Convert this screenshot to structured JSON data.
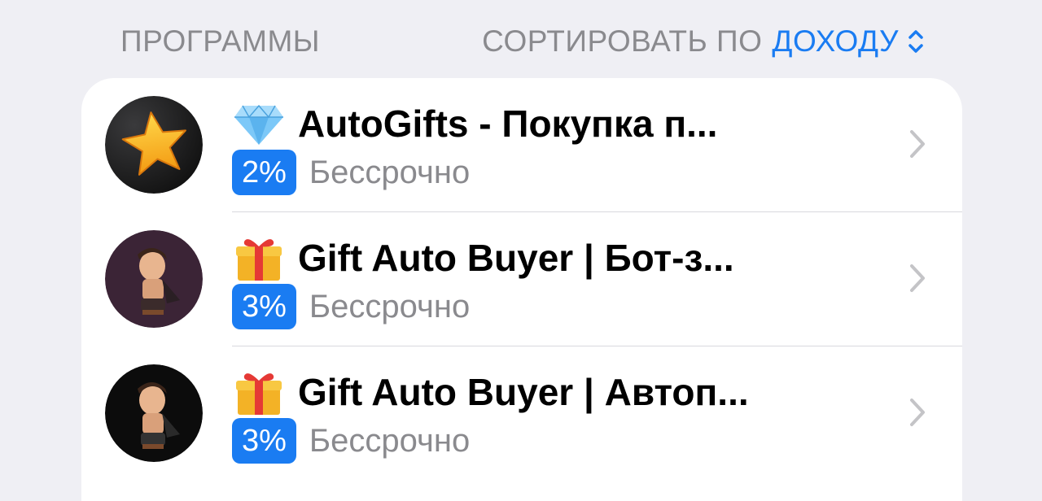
{
  "header": {
    "section_title": "ПРОГРАММЫ",
    "sort_prefix": "СОРТИРОВАТЬ ПО",
    "sort_value": "ДОХОДУ"
  },
  "colors": {
    "accent": "#1a7cf2",
    "secondary_text": "#8a8a8e",
    "background": "#efeff4"
  },
  "programs": [
    {
      "title": "AutoGifts - Покупка п...",
      "emoji": "gem-icon",
      "percent": "2%",
      "duration": "Бессрочно",
      "avatar": "star-avatar"
    },
    {
      "title": "Gift Auto Buyer | Бот-з...",
      "emoji": "gift-icon",
      "percent": "3%",
      "duration": "Бессрочно",
      "avatar": "character-avatar-purple"
    },
    {
      "title": "Gift Auto Buyer | Автоп...",
      "emoji": "gift-icon",
      "percent": "3%",
      "duration": "Бессрочно",
      "avatar": "character-avatar-black"
    }
  ]
}
